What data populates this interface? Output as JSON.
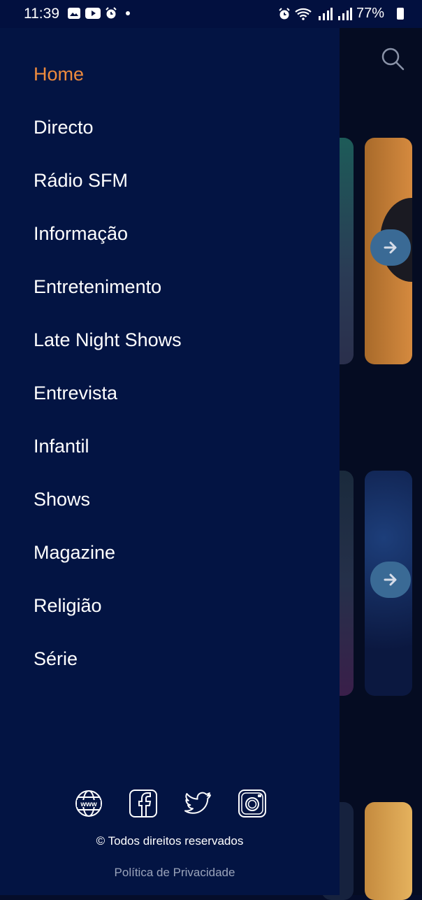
{
  "status_bar": {
    "time": "11:39",
    "battery": "77%",
    "left_icons": [
      "gallery-icon",
      "youtube-icon",
      "alarm-icon",
      "notification-dot"
    ],
    "right_icons": [
      "alarm-icon",
      "wifi-icon",
      "signal-icon",
      "signal-icon",
      "battery-icon"
    ]
  },
  "drawer": {
    "menu": [
      {
        "label": "Home",
        "active": true
      },
      {
        "label": "Directo"
      },
      {
        "label": "Rádio SFM"
      },
      {
        "label": "Informação"
      },
      {
        "label": "Entretenimento"
      },
      {
        "label": "Late Night Shows"
      },
      {
        "label": "Entrevista"
      },
      {
        "label": "Infantil"
      },
      {
        "label": "Shows"
      },
      {
        "label": "Magazine"
      },
      {
        "label": "Religião"
      },
      {
        "label": "Série"
      }
    ],
    "social": [
      "globe-icon",
      "facebook-icon",
      "twitter-icon",
      "instagram-icon"
    ],
    "copyright": "© Todos direitos reservados",
    "privacy": "Política de Privacidade"
  },
  "colors": {
    "drawer_bg": "#031443",
    "accent": "#ee8a3d",
    "text": "#ffffff",
    "muted": "#9aa3ba"
  }
}
